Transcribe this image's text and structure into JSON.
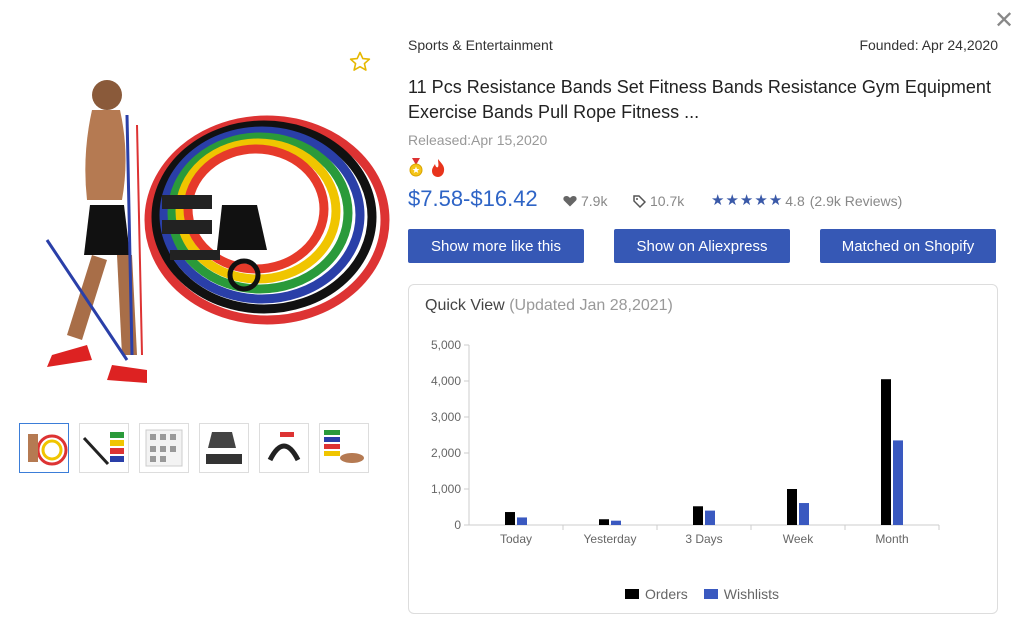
{
  "header": {
    "category": "Sports & Entertainment",
    "founded": "Founded: Apr 24,2020",
    "close_icon": "close-icon"
  },
  "product": {
    "title": "11 Pcs Resistance Bands Set Fitness Bands Resistance Gym Equipment Exercise Bands Pull Rope Fitness ...",
    "released": "Released:Apr 15,2020",
    "price": "$7.58-$16.42",
    "likes": "7.9k",
    "tags": "10.7k",
    "rating": "4.8",
    "reviews": "(2.9k Reviews)",
    "star_count": 5
  },
  "buttons": {
    "more_like": "Show more like this",
    "aliexpress": "Show on Aliexpress",
    "shopify": "Matched on Shopify"
  },
  "quick_view": {
    "title": "Quick View",
    "updated": "(Updated Jan 28,2021)"
  },
  "colors": {
    "accent": "#3658b5",
    "price": "#2e64c6",
    "orders": "#000000",
    "wishlists": "#3a59c0"
  },
  "chart_data": {
    "type": "bar",
    "categories": [
      "Today",
      "Yesterday",
      "3 Days",
      "Week",
      "Month"
    ],
    "series": [
      {
        "name": "Orders",
        "values": [
          360,
          160,
          520,
          1000,
          4050
        ]
      },
      {
        "name": "Wishlists",
        "values": [
          210,
          120,
          400,
          610,
          2350
        ]
      }
    ],
    "yticks": [
      "0",
      "1,000",
      "2,000",
      "3,000",
      "4,000",
      "5,000"
    ],
    "ylim": [
      0,
      5000
    ],
    "legend": "bottom",
    "grid": false
  }
}
